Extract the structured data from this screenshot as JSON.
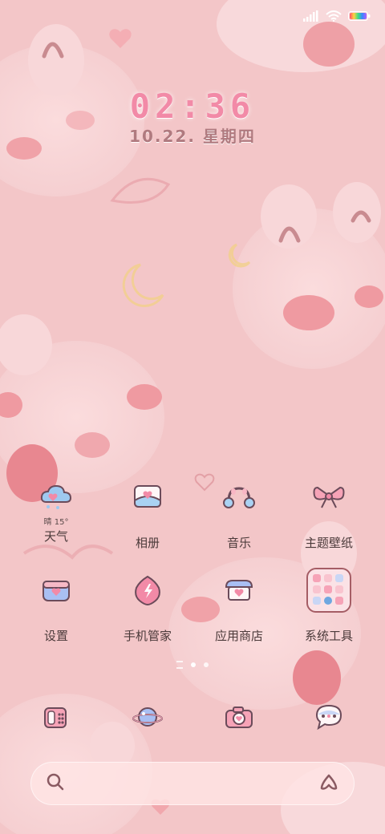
{
  "status_bar": {
    "signal_icon": "signal-bars-icon",
    "wifi_icon": "wifi-icon",
    "battery_icon": "battery-icon"
  },
  "lock_clock": {
    "time": "02:36",
    "date": "10.22. 星期四"
  },
  "home_grid": {
    "row1": [
      {
        "label": "天气",
        "sub": "晴 15°",
        "icon": "weather-cloud-icon"
      },
      {
        "label": "相册",
        "icon": "photo-album-icon"
      },
      {
        "label": "音乐",
        "icon": "headphones-icon"
      },
      {
        "label": "主题壁纸",
        "icon": "bow-icon"
      }
    ],
    "row2": [
      {
        "label": "设置",
        "icon": "settings-box-icon"
      },
      {
        "label": "手机管家",
        "icon": "security-shield-icon"
      },
      {
        "label": "应用商店",
        "icon": "app-store-house-icon"
      },
      {
        "label": "系统工具",
        "icon": "folder-icon"
      }
    ]
  },
  "page_indicator": {
    "pages": 2,
    "current": 1
  },
  "dock": [
    {
      "icon": "phone-icon"
    },
    {
      "icon": "planet-browser-icon"
    },
    {
      "icon": "camera-icon"
    },
    {
      "icon": "message-bubble-icon"
    }
  ],
  "search_bar": {
    "search_icon": "search-icon",
    "right_icon": "assistant-a-icon"
  },
  "colors": {
    "background": "#f3c6c8",
    "accent_pink": "#f28aa7",
    "date_color": "#b07a7f",
    "label_color": "#4b3a3a"
  }
}
